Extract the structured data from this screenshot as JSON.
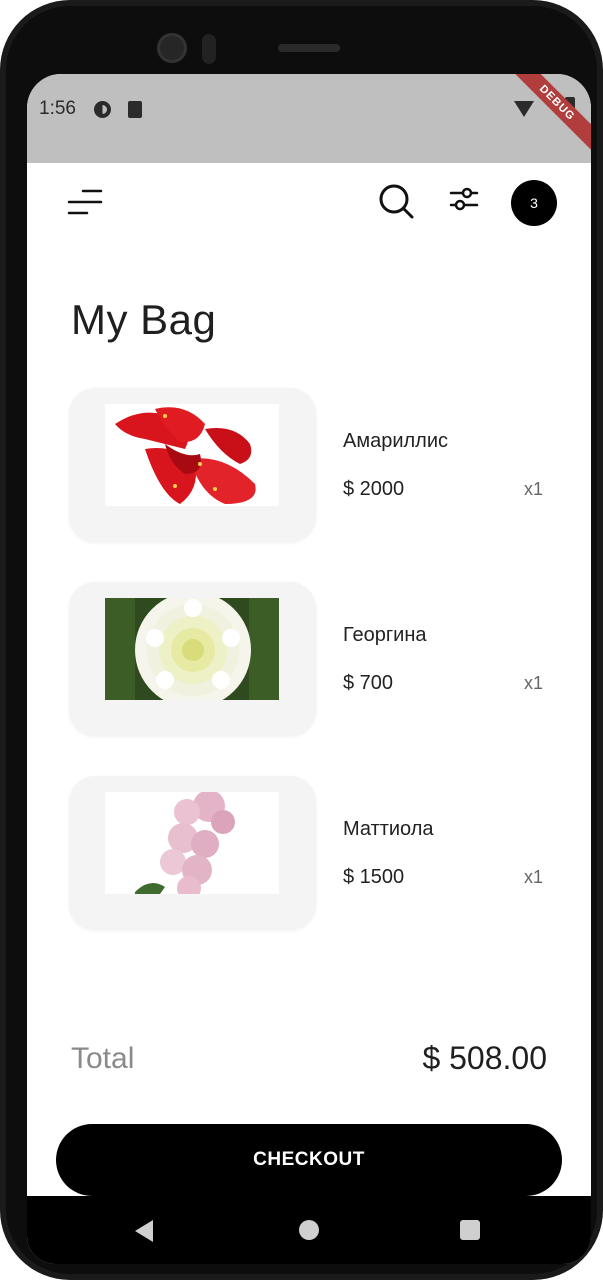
{
  "status_bar": {
    "time": "1:56",
    "debug_label": "DEBUG"
  },
  "app_bar": {
    "menu_icon": "menu-icon",
    "search_icon": "search-icon",
    "filter_icon": "filter-icon",
    "cart_count": "3"
  },
  "page": {
    "title": "My Bag"
  },
  "items": [
    {
      "name": "Амариллис",
      "price": "$ 2000",
      "quantity": "x1",
      "image": "red-amaryllis-flower"
    },
    {
      "name": "Георгина",
      "price": "$ 700",
      "quantity": "x1",
      "image": "white-dahlia-flower"
    },
    {
      "name": "Маттиола",
      "price": "$ 1500",
      "quantity": "x1",
      "image": "pink-matthiola-flower"
    }
  ],
  "summary": {
    "total_label": "Total",
    "total_value": "$ 508.00"
  },
  "checkout": {
    "label": "CHECKOUT"
  },
  "colors": {
    "accent": "#000000",
    "card_bg": "#f4f4f4",
    "status_bar_bg": "#bfbfbf"
  }
}
